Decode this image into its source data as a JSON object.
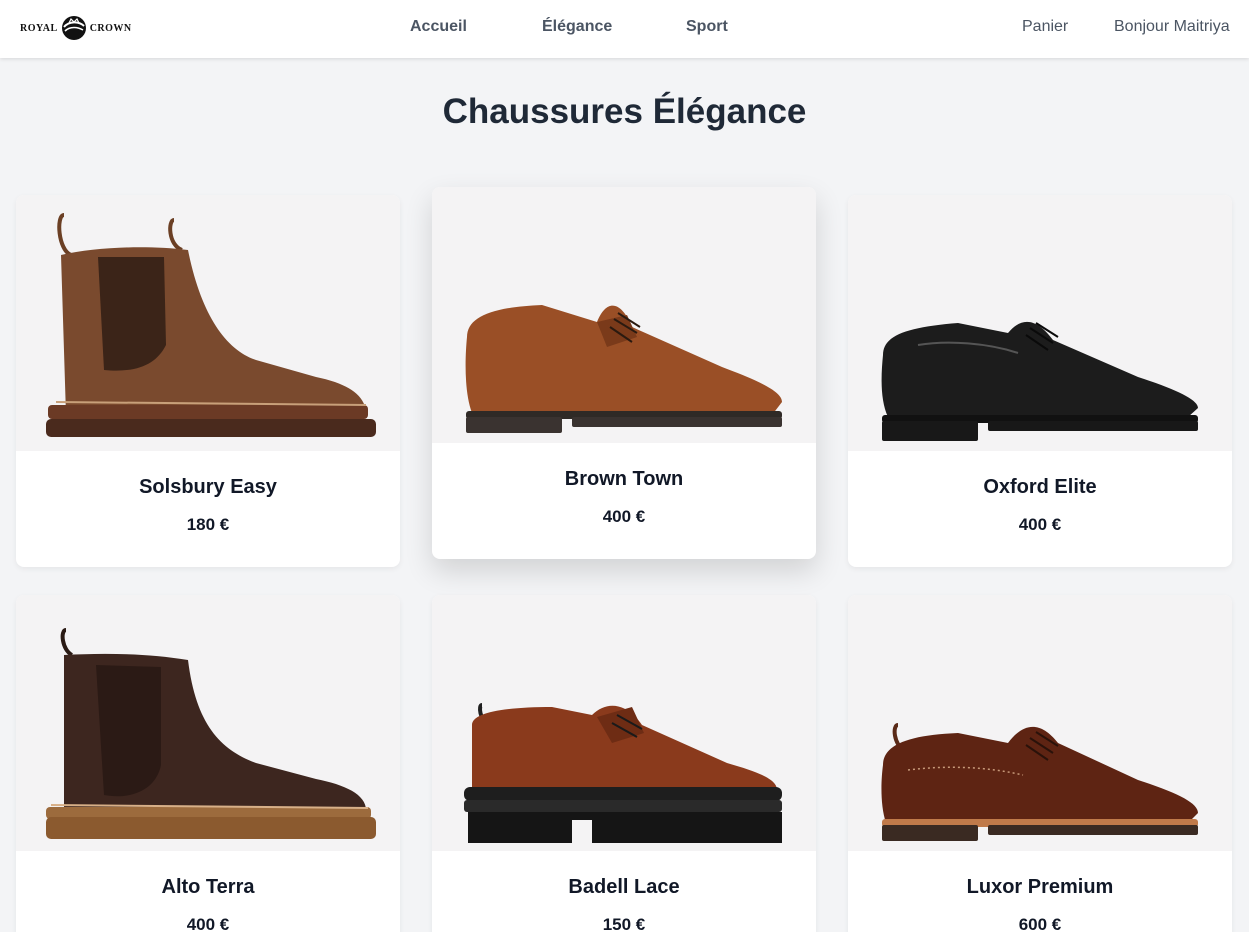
{
  "brand": {
    "left_word": "ROYAL",
    "right_word": "CROWN"
  },
  "nav": {
    "home": "Accueil",
    "elegance": "Élégance",
    "sport": "Sport",
    "cart": "Panier",
    "greeting": "Bonjour Maitriya"
  },
  "page": {
    "title": "Chaussures Élégance"
  },
  "products": [
    {
      "name": "Solsbury Easy",
      "price": "180 €",
      "image": "brown-chelsea-boot"
    },
    {
      "name": "Brown Town",
      "price": "400 €",
      "image": "brown-derby-shoe"
    },
    {
      "name": "Oxford Elite",
      "price": "400 €",
      "image": "black-derby-shoe"
    },
    {
      "name": "Alto Terra",
      "price": "400 €",
      "image": "dark-brown-suede-chelsea-boot"
    },
    {
      "name": "Badell Lace",
      "price": "150 €",
      "image": "rust-suede-lace-shoe"
    },
    {
      "name": "Luxor Premium",
      "price": "600 €",
      "image": "brown-brogue-shoe"
    }
  ],
  "colors": {
    "background": "#f3f4f6",
    "card": "#ffffff",
    "nav_text": "#4b5563",
    "title": "#1f2937"
  }
}
